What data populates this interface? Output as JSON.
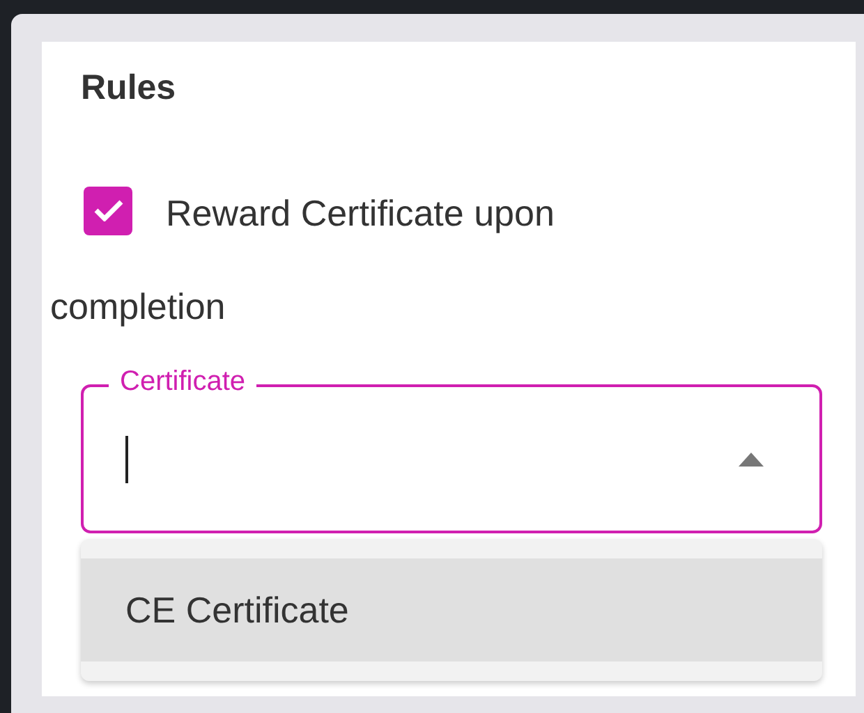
{
  "section": {
    "title": "Rules"
  },
  "reward_checkbox": {
    "label_lines": [
      "Reward Certificate upon",
      "completion"
    ],
    "checked": true
  },
  "certificate_field": {
    "label": "Certificate",
    "focused": true,
    "open": true
  },
  "options": [
    {
      "label": "CE Certificate",
      "highlighted": true
    }
  ]
}
